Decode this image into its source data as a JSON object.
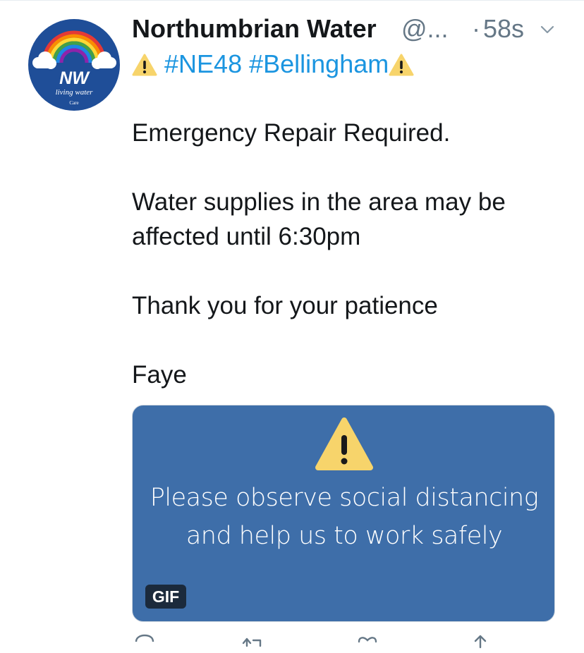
{
  "tweet": {
    "display_name": "Northumbrian Water",
    "handle": "@...",
    "separator": "·",
    "timestamp": "58s",
    "hashtags": [
      "#NE48",
      "#Bellingham"
    ],
    "paragraphs": [
      "Emergency Repair Required.",
      "Water supplies in the area may be affected until 6:30pm",
      "Thank you for your patience",
      "Faye"
    ]
  },
  "avatar": {
    "logo_text": "NW",
    "tagline": "living water",
    "sub": "Care"
  },
  "media": {
    "caption": "Please observe social distancing and help us to work safely",
    "badge": "GIF",
    "background": "#3e6ea9"
  },
  "icons": {
    "warning": "warning-icon",
    "caret": "chevron-down-icon",
    "reply": "reply-icon",
    "retweet": "retweet-icon",
    "like": "like-icon",
    "share": "share-icon"
  },
  "colors": {
    "link": "#1b95e0",
    "secondary_text": "#657786",
    "warning_yellow": "#f7d46b"
  }
}
